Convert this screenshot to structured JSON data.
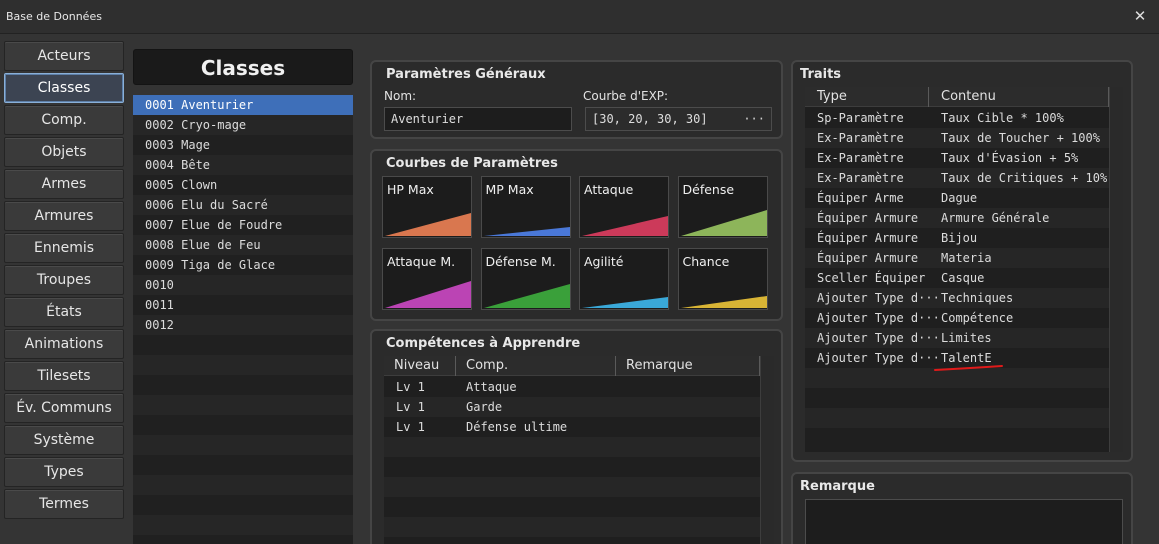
{
  "window": {
    "title": "Base de Données",
    "close_glyph": "✕"
  },
  "nav": {
    "items": [
      "Acteurs",
      "Classes",
      "Comp.",
      "Objets",
      "Armes",
      "Armures",
      "Ennemis",
      "Troupes",
      "États",
      "Animations",
      "Tilesets",
      "Év. Communs",
      "Système",
      "Types",
      "Termes"
    ],
    "active_index": 1
  },
  "class_list": {
    "header": "Classes",
    "items": [
      "0001 Aventurier",
      "0002 Cryo-mage",
      "0003 Mage",
      "0004 Bête",
      "0005 Clown",
      "0006 Elu du Sacré",
      "0007 Elue de Foudre",
      "0008 Elue de Feu",
      "0009 Tiga de Glace",
      "0010",
      "0011",
      "0012"
    ],
    "selected_index": 0
  },
  "general": {
    "title": "Paramètres Généraux",
    "name_label": "Nom:",
    "name_value": "Aventurier",
    "exp_label": "Courbe d'EXP:",
    "exp_value": "[30, 20, 30, 30]",
    "exp_button_glyph": "···"
  },
  "curves": {
    "title": "Courbes de Paramètres",
    "items": [
      {
        "label": "HP Max",
        "color": "#d9774f",
        "level": 0.65
      },
      {
        "label": "MP Max",
        "color": "#4a78d8",
        "level": 0.25
      },
      {
        "label": "Attaque",
        "color": "#cc3a5a",
        "level": 0.55
      },
      {
        "label": "Défense",
        "color": "#8db55a",
        "level": 0.72
      },
      {
        "label": "Attaque M.",
        "color": "#bb44b4",
        "level": 0.75
      },
      {
        "label": "Défense M.",
        "color": "#3aa03a",
        "level": 0.68
      },
      {
        "label": "Agilité",
        "color": "#3aa8d8",
        "level": 0.3
      },
      {
        "label": "Chance",
        "color": "#d8b435",
        "level": 0.32
      }
    ]
  },
  "skills": {
    "title": "Compétences à Apprendre",
    "columns": [
      "Niveau",
      "Comp.",
      "Remarque"
    ],
    "rows": [
      {
        "level": "Lv  1",
        "skill": "Attaque"
      },
      {
        "level": "Lv  1",
        "skill": "Garde"
      },
      {
        "level": "Lv  1",
        "skill": "Défense ultime"
      }
    ]
  },
  "traits": {
    "title": "Traits",
    "columns": [
      "Type",
      "Contenu"
    ],
    "rows": [
      {
        "type": "Sp-Paramètre",
        "content": "Taux Cible * 100%"
      },
      {
        "type": "Ex-Paramètre",
        "content": "Taux de Toucher + 100%"
      },
      {
        "type": "Ex-Paramètre",
        "content": "Taux d'Évasion + 5%"
      },
      {
        "type": "Ex-Paramètre",
        "content": "Taux de Critiques + 10%"
      },
      {
        "type": "Équiper Arme",
        "content": "Dague"
      },
      {
        "type": "Équiper Armure",
        "content": "Armure Générale"
      },
      {
        "type": "Équiper Armure",
        "content": "Bijou"
      },
      {
        "type": "Équiper Armure",
        "content": "Materia"
      },
      {
        "type": "Sceller Équiper",
        "content": "Casque"
      },
      {
        "type": "Ajouter Type d···",
        "content": "Techniques"
      },
      {
        "type": "Ajouter Type d···",
        "content": "Compétence"
      },
      {
        "type": "Ajouter Type d···",
        "content": "Limites"
      },
      {
        "type": "Ajouter Type d···",
        "content": "TalentE"
      }
    ],
    "annotation_color": "#e01a1a"
  },
  "remark": {
    "title": "Remarque"
  },
  "colors": {
    "selection": "#3e6fb9",
    "active_border": "#8ab0d8"
  }
}
